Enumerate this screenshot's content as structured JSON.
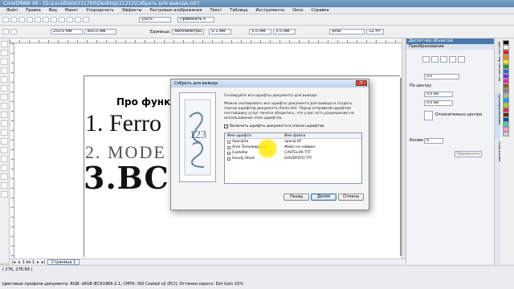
{
  "window": {
    "title": "CorelDRAW X6 - [D:\\LocalData\\Y11790\\Desktop\\11212\\Собрать для вывода.cdr]"
  },
  "menu": [
    "Файл",
    "Правка",
    "Вид",
    "Макет",
    "Упорядочить",
    "Эффекты",
    "Растровые изображения",
    "Текст",
    "Таблица",
    "Инструменты",
    "Окно",
    "Справка"
  ],
  "toolbar": {
    "zoom": "100%",
    "snap": "Привязать к",
    "width": "250.0 мм",
    "height": "300.0 мм",
    "units_label": "Единицы:",
    "units": "миллиметры",
    "nudge": "0.1 мм",
    "dup_x": "5.0 мм",
    "dup_y": "5.0 мм",
    "font": "Arial",
    "font_size": "12 пт"
  },
  "document": {
    "heading": "Про функц",
    "line1": "1. Ferro",
    "line2": "2. MODE",
    "line3": "3.BC"
  },
  "page_nav": {
    "position": "1 из 1",
    "tab": "Страница 1"
  },
  "docker": {
    "title": "Диспетчер объектов",
    "subtitle": "Преобразование",
    "angle": "0.0",
    "center_label": "По центру",
    "x": "0.0 мм",
    "y": "0.0 мм",
    "relative_label": "Относительно центра",
    "copies_label": "Копии:",
    "copies": "0",
    "apply": "Применить"
  },
  "side_tabs": [
    "Диспетчер объектов",
    "Преобразование",
    "Подсказки"
  ],
  "status": {
    "coords": "( 276, 276.99 )",
    "profiles": "Цветовые профили документа: RGB: sRGB IEC61966-2.1; CMYK: ISO Coated v2 (ECI); Оттенки серого: Dot Gain 15%"
  },
  "dialog": {
    "title": "Собрать для вывода",
    "close": "✕",
    "intro": "Скопируйте все шрифты документа для вывода.",
    "body": "Можно скопировать все шрифты документа для вывода и создать список шрифтов документа (fonts.txt). Перед отправкой шрифтов поставщику услуг печати убедитесь, что у вас есть разрешение на использование этих шрифтов.",
    "checkbox_label": "Включить шрифты документа и список шрифтов",
    "checkbox_mark": "✓",
    "table_headers": [
      "Имя шрифта",
      "Имя файла"
    ],
    "fonts": [
      {
        "name": "Aparajita",
        "file": "aparaj.ttf"
      },
      {
        "name": "Arial Полужирный",
        "file": "Файл не найден"
      },
      {
        "name": "Castellar",
        "file": "CASTELAR.TTF"
      },
      {
        "name": "Goudy Stout",
        "file": "GOUDYSTO.TTF"
      }
    ],
    "buttons": {
      "back": "Назад",
      "next": "Далее",
      "cancel": "Отмена"
    }
  },
  "colors": {
    "accent": "#4a79ad",
    "highlight": "#ffe600"
  },
  "palette": [
    "#000000",
    "#ffffff",
    "#e11c1c",
    "#f08a1c",
    "#ffe600",
    "#2a9b37",
    "#1c6de1",
    "#7a2ae1",
    "#e12a9b",
    "#8a5a2a",
    "#7f7f7f",
    "#b3b3b3",
    "#00a3d9",
    "#9bd92a",
    "#d92a5a",
    "#5a2a00",
    "#004f9b",
    "#2ad9b3",
    "#ff9bd9",
    "#cccccc"
  ]
}
